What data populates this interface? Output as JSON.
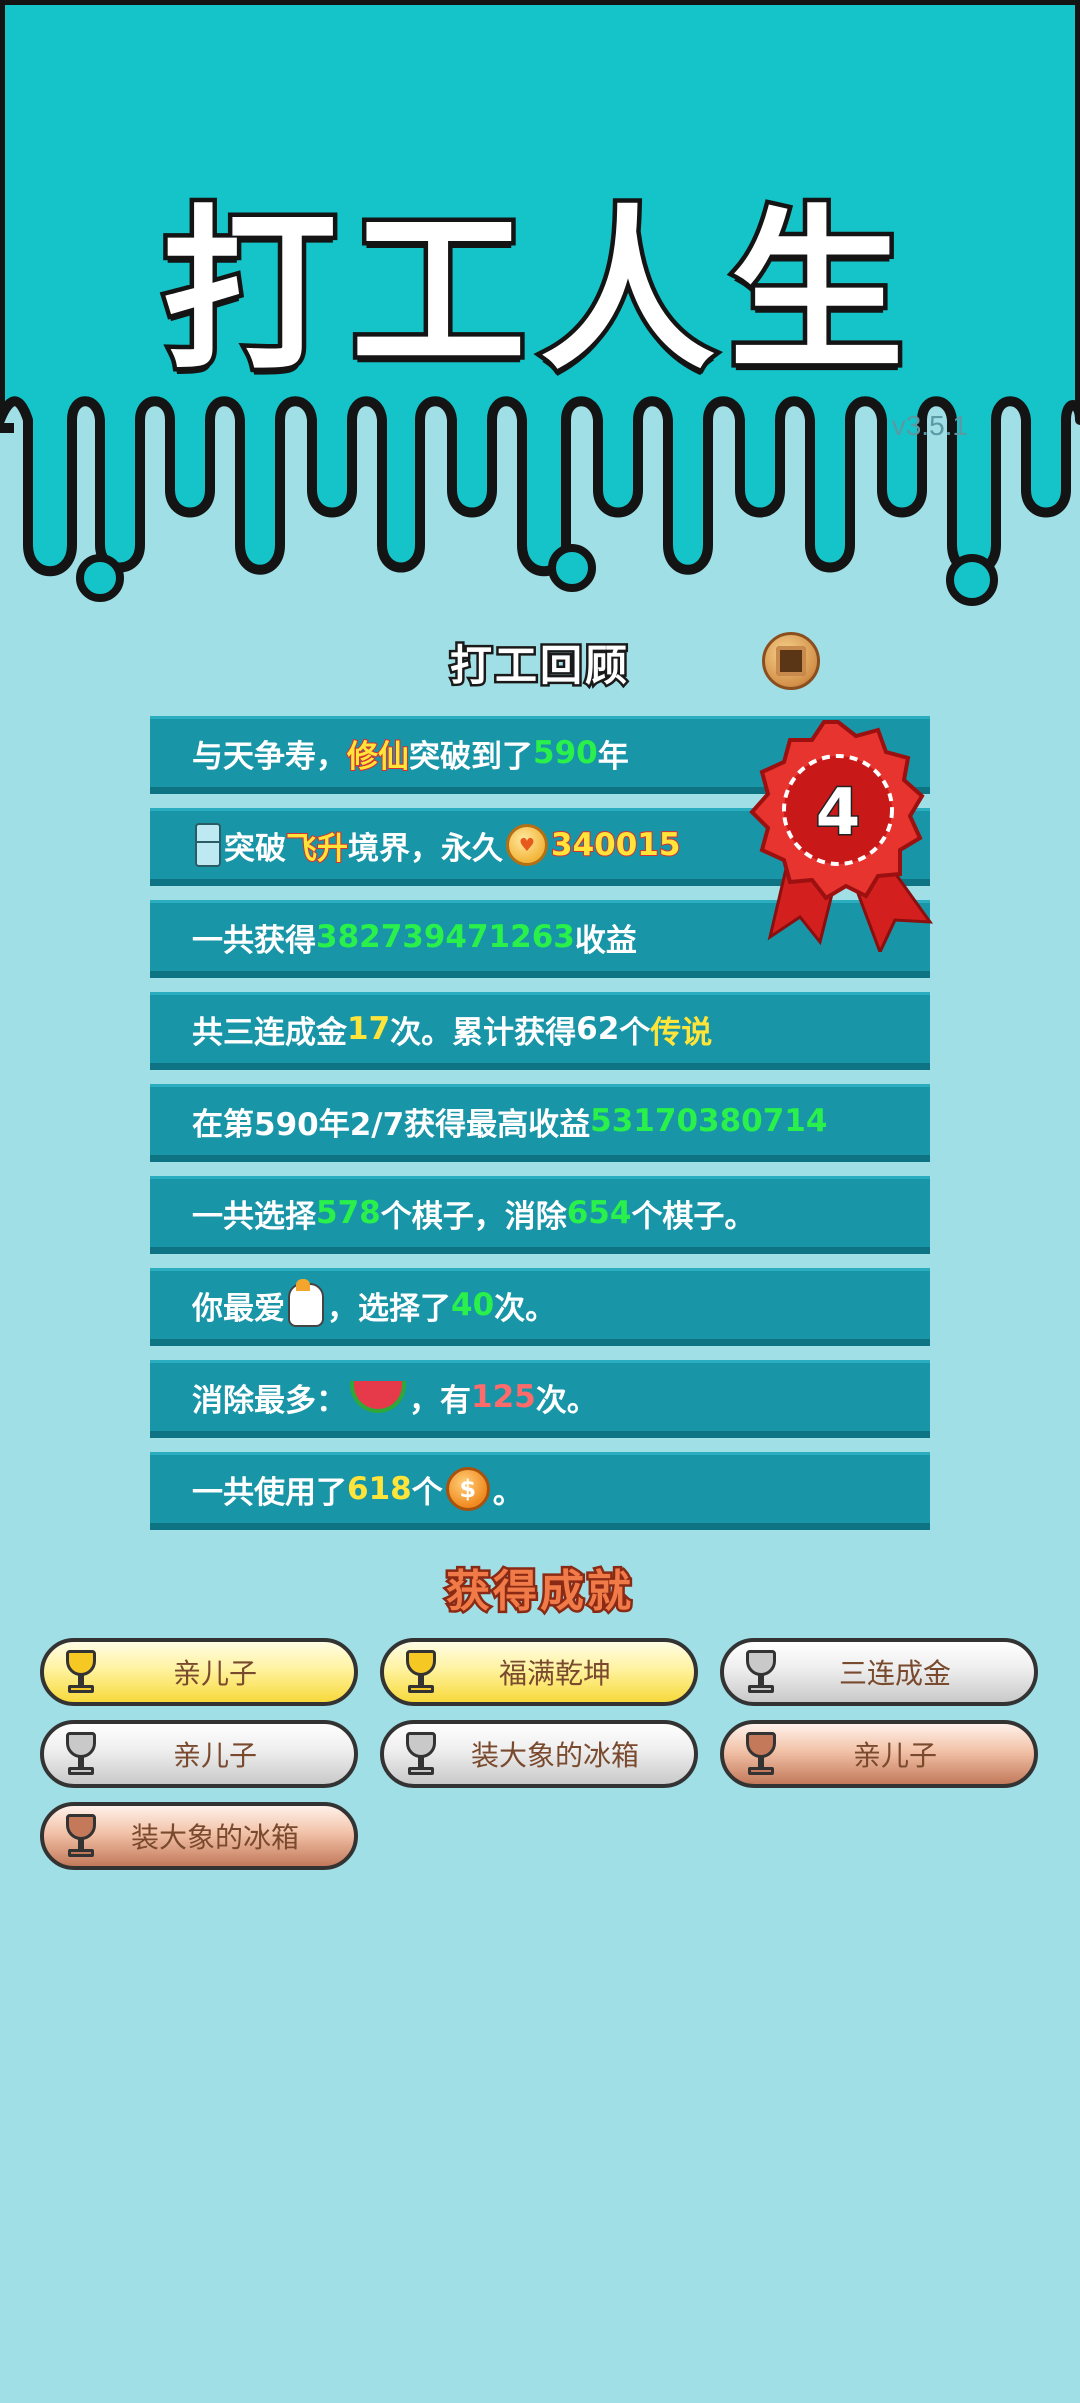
{
  "header": {
    "title": "打工人生",
    "version": "v3.5.1"
  },
  "review": {
    "title": "打工回顾",
    "rank_number": "4",
    "rows": [
      {
        "a": "与天争寿，",
        "b": "修仙",
        "c": "突破到了",
        "d": "590",
        "e": "年"
      },
      {
        "a": "突破",
        "b": "飞升",
        "c": "境界，永久",
        "d": "340015"
      },
      {
        "a": "一共获得",
        "b": "382739471263",
        "c": "收益"
      },
      {
        "a": "共",
        "b": "三连成金",
        "c": "17",
        "d": "次。累计获得",
        "e": "62",
        "f": "个",
        "g": "传说"
      },
      {
        "a": "在 ",
        "b": "第590年2/7",
        "c": " 获得最高收益",
        "d": "53170380714"
      },
      {
        "a": "一共选择",
        "b": "578",
        "c": "个棋子，消除",
        "d": "654",
        "e": "个棋子。"
      },
      {
        "a": "你最爱",
        "b": "，选择了",
        "c": "40",
        "d": "次。"
      },
      {
        "a": "消除最多：",
        "b": "，有",
        "c": "125",
        "d": "次。"
      },
      {
        "a": "一共使用了",
        "b": "618",
        "c": "个",
        "d": "。"
      }
    ]
  },
  "achievements": {
    "title": "获得成就",
    "items": [
      {
        "label": "亲儿子",
        "tier": "gold"
      },
      {
        "label": "福满乾坤",
        "tier": "gold"
      },
      {
        "label": "三连成金",
        "tier": "silver"
      },
      {
        "label": "亲儿子",
        "tier": "silver"
      },
      {
        "label": "装大象的冰箱",
        "tier": "silver"
      },
      {
        "label": "亲儿子",
        "tier": "bronze"
      },
      {
        "label": "装大象的冰箱",
        "tier": "bronze"
      }
    ]
  },
  "icons": [
    "fridge-icon",
    "coin-icon",
    "horse-icon",
    "watermelon-icon",
    "dollar-coin-icon",
    "trophy-icon",
    "rank-medal-icon",
    "ribbon-medal-icon"
  ],
  "colors": {
    "sky": "#14c4c8",
    "background": "#a0dfe6",
    "row": "#1895a7",
    "green_value": "#29f04a",
    "yellow_value": "#ffe53a",
    "red_value": "#ff6b6b"
  }
}
